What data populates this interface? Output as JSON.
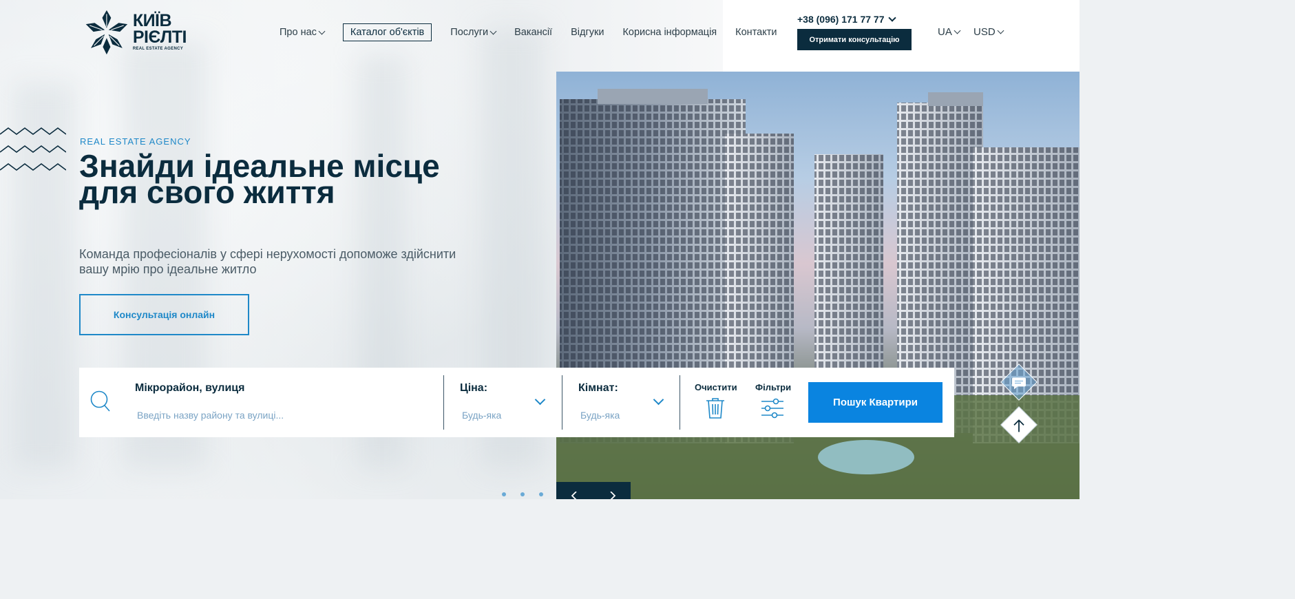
{
  "brand": {
    "name_line1": "КИЇВ",
    "name_line2": "РІЄЛТІ",
    "tagline": "REAL ESTATE AGENCY",
    "logo_icon": "snowflake-logo-icon",
    "color_dark": "#0b2c3e",
    "color_accent": "#1e88c8",
    "color_button": "#0a84e0"
  },
  "nav": {
    "items": [
      {
        "label": "Про нас",
        "has_dropdown": true
      },
      {
        "label": "Каталог об'єктів",
        "has_dropdown": false,
        "active": true
      },
      {
        "label": "Послуги",
        "has_dropdown": true
      },
      {
        "label": "Вакансії",
        "has_dropdown": false
      },
      {
        "label": "Відгуки",
        "has_dropdown": false
      },
      {
        "label": "Корисна інформація",
        "has_dropdown": false
      },
      {
        "label": "Контакти",
        "has_dropdown": false
      }
    ]
  },
  "header": {
    "phone": "+38 (096) 171 77 77",
    "consult_button": "Отримати консультацію",
    "language": "UA",
    "currency": "USD"
  },
  "hero": {
    "eyebrow": "REAL ESTATE AGENCY",
    "title": "Знайди ідеальне місце для свого життя",
    "subtitle": "Команда професіоналів у сфері нерухомості допоможе здійснити вашу мрію про ідеальне житло",
    "cta": "Консультація онлайн"
  },
  "search": {
    "location_label": "Мікрорайон, вулиця",
    "location_placeholder": "Введіть назву району та вулиці...",
    "price_label": "Ціна:",
    "price_value": "Будь-яка",
    "rooms_label": "Кімнат:",
    "rooms_value": "Будь-яка",
    "clear_label": "Очистити",
    "filters_label": "Фільтри",
    "submit": "Пошук Квартири"
  },
  "floating": {
    "chat_icon": "chat-icon",
    "up_icon": "arrow-up-icon"
  }
}
